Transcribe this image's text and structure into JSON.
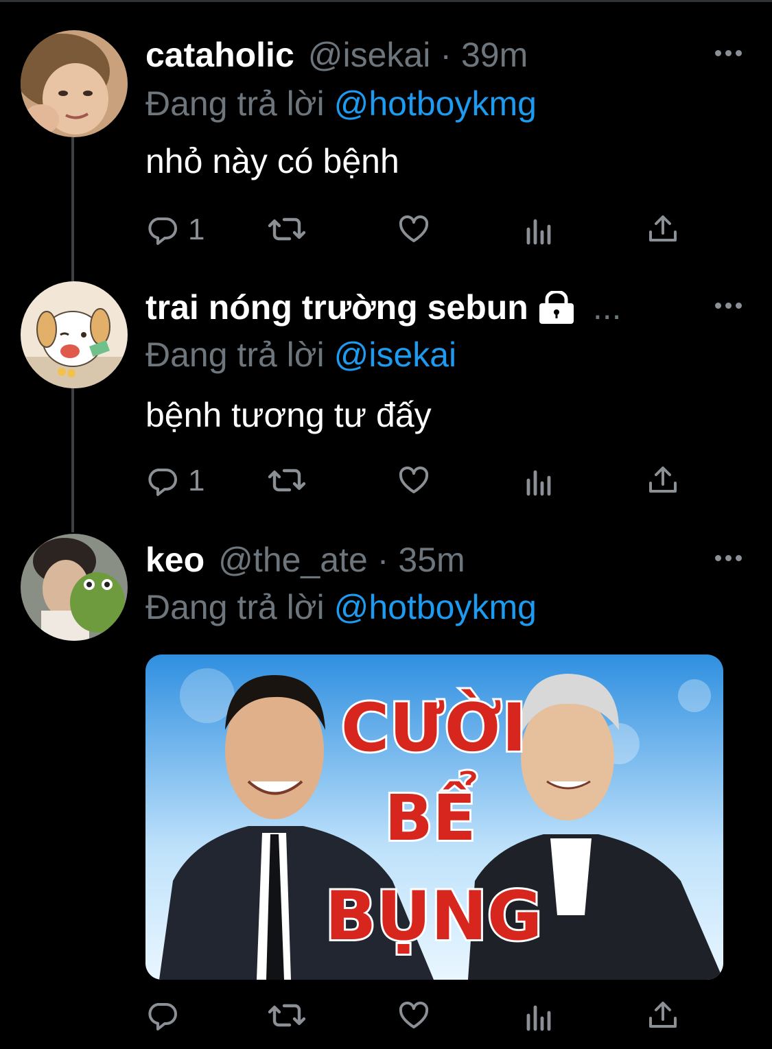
{
  "tweets": [
    {
      "name": "cataholic",
      "handle": "@isekai",
      "time": "39m",
      "reply_prefix": "Đang trả lời",
      "reply_to": "@hotboykmg",
      "text": "nhỏ này có bệnh",
      "reply_count": "1"
    },
    {
      "name": "trai nóng trường sebun",
      "locked": true,
      "truncated": "...",
      "reply_prefix": "Đang trả lời",
      "reply_to": "@isekai",
      "text": "bệnh tương tư đấy",
      "reply_count": "1"
    },
    {
      "name": "keo",
      "handle": "@the_ate",
      "time": "35m",
      "reply_prefix": "Đang trả lời",
      "reply_to": "@hotboykmg",
      "media": {
        "line1": "CƯỜI",
        "line2": "BỂ",
        "line3": "BỤNG"
      }
    }
  ],
  "separator": "·",
  "icons": {
    "reply": "reply-icon",
    "retweet": "retweet-icon",
    "like": "heart-icon",
    "views": "bar-chart-icon",
    "share": "share-icon",
    "more": "more-dots-icon",
    "lock": "lock-icon"
  },
  "colors": {
    "background": "#000000",
    "mention": "#1d9bf0",
    "secondary_text": "#6e767d",
    "icon": "#8b9096",
    "media_title": "#d7261e"
  }
}
